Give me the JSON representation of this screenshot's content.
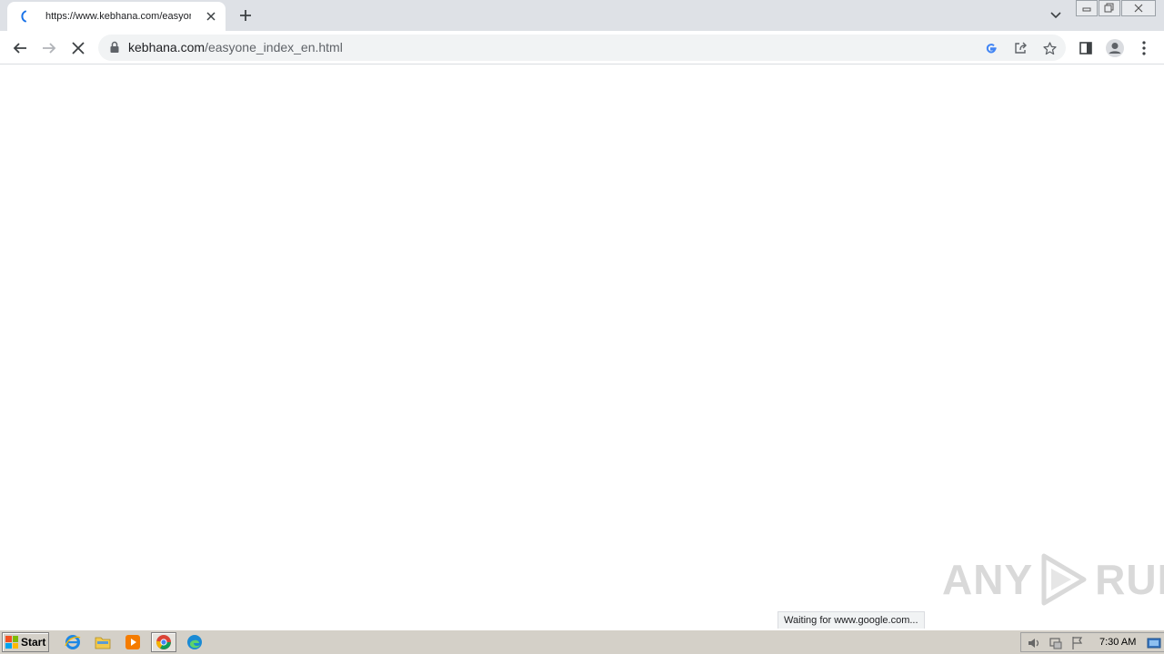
{
  "tab": {
    "title": "https://www.kebhana.com/easyone_index_en.html"
  },
  "omnibox": {
    "domain": "kebhana.com",
    "path": "/easyone_index_en.html"
  },
  "status_bar": {
    "text": "Waiting for www.google.com..."
  },
  "watermark": {
    "left": "ANY",
    "right": "RUN"
  },
  "taskbar": {
    "start_label": "Start",
    "clock": "7:30 AM",
    "apps": [
      "internet-explorer",
      "file-explorer",
      "media-player",
      "chrome",
      "edge"
    ]
  },
  "colors": {
    "tabstrip": "#dee1e6",
    "omnibox": "#f1f3f4",
    "icon": "#5f6368",
    "taskbar": "#d4d0c8",
    "spinner": "#1a73e8"
  }
}
